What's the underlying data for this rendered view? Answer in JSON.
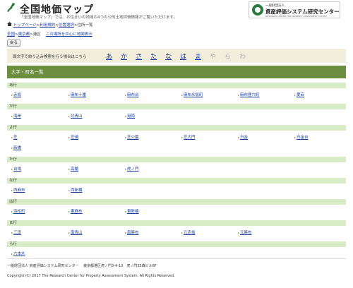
{
  "header": {
    "title": "全国地価マップ",
    "description": "「全国地価マップ」では、お住まいの地域の4つの公的土地評価情報がご覧いただけます。",
    "org": {
      "small": "一般財団法人",
      "name": "資産評価システム研究センター",
      "en": "RESEARCH CENTER FOR PROPERTY ASSESSMENT SYSTEM"
    }
  },
  "breadcrumb_top": {
    "home": "トップページ",
    "terms": "利用規約",
    "location": "位置選択",
    "current": "住所一覧"
  },
  "breadcrumb_area": {
    "prefecture": "全国",
    "city": "東京都",
    "ward": "港区",
    "center_link": "この場所を中心に地図表示"
  },
  "back_label": "戻る",
  "kana_filter": {
    "label": "頭文字で絞り込み検索を行う場合はこちら",
    "items": [
      {
        "t": "あ",
        "on": true
      },
      {
        "t": "か",
        "on": true
      },
      {
        "t": "さ",
        "on": true
      },
      {
        "t": "た",
        "on": true
      },
      {
        "t": "な",
        "on": true
      },
      {
        "t": "は",
        "on": true
      },
      {
        "t": "ま",
        "on": true
      },
      {
        "t": "や",
        "on": false
      },
      {
        "t": "ら",
        "on": false
      },
      {
        "t": "わ",
        "on": false
      }
    ]
  },
  "list_title": "大字・町名一覧",
  "groups": [
    {
      "label": "あ行",
      "items": [
        "赤坂",
        "麻布十番",
        "麻布台",
        "麻布永坂町",
        "麻布狸穴町",
        "愛宕"
      ]
    },
    {
      "label": "か行",
      "items": [
        "海岸",
        "北青山",
        "港南"
      ]
    },
    {
      "label": "さ行",
      "items": [
        "芝",
        "芝浦",
        "芝公園",
        "芝大門",
        "白金",
        "白金台",
        "新橋"
      ]
    },
    {
      "label": "た行",
      "items": [
        "台場",
        "高輪",
        "虎ノ門"
      ]
    },
    {
      "label": "な行",
      "items": [
        "西麻布",
        "西新橋"
      ]
    },
    {
      "label": "は行",
      "items": [
        "浜松町",
        "東麻布",
        "東新橋"
      ]
    },
    {
      "label": "ま行",
      "items": [
        "三田",
        "南青山",
        "南麻布",
        "元赤坂",
        "元麻布"
      ]
    },
    {
      "label": "ら行",
      "items": [
        "六本木"
      ]
    }
  ],
  "footer": {
    "address": "一般財団法人 資産評価システム研究センター　 東京都港区虎ノ門3-4-10　虎ノ門35森ビル8F",
    "copyright": "Copyright (C) 2017 The Research Center for Property Assessment System. All Rights Reserved."
  }
}
